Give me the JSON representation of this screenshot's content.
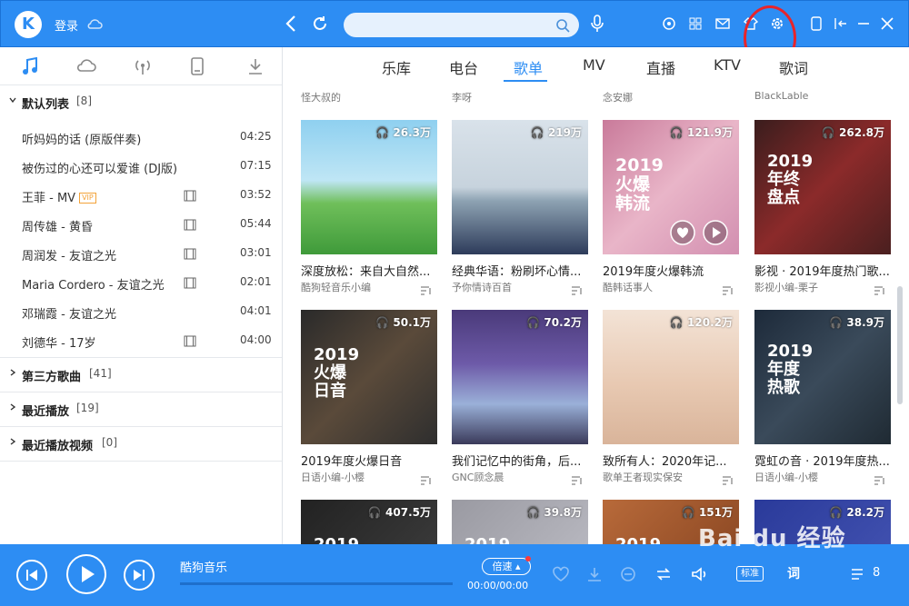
{
  "app": {
    "logo_letter": "K",
    "login": "登录",
    "search_placeholder": ""
  },
  "sidebar": {
    "groups": [
      {
        "name": "默认列表",
        "count": "[8]",
        "expanded": true
      },
      {
        "name": "第三方歌曲",
        "count": "[41]",
        "expanded": false
      },
      {
        "name": "最近播放",
        "count": "[19]",
        "expanded": false
      },
      {
        "name": "最近播放视频",
        "count": "[0]",
        "expanded": false
      }
    ],
    "songs": [
      {
        "name": "听妈妈的话 (原版伴奏)",
        "dur": "04:25",
        "mv": false,
        "vip": false
      },
      {
        "name": "被伤过的心还可以爱谁 (DJ版)",
        "dur": "07:15",
        "mv": false,
        "vip": false
      },
      {
        "name": "王菲 - MV",
        "dur": "03:52",
        "mv": true,
        "vip": true
      },
      {
        "name": "周传雄 - 黄昏",
        "dur": "05:44",
        "mv": true,
        "vip": false
      },
      {
        "name": "周润发 - 友谊之光",
        "dur": "03:01",
        "mv": true,
        "vip": false
      },
      {
        "name": "Maria Cordero - 友谊之光",
        "dur": "02:01",
        "mv": true,
        "vip": false
      },
      {
        "name": "邓瑞霞 - 友谊之光",
        "dur": "04:01",
        "mv": false,
        "vip": false
      },
      {
        "name": "刘德华 - 17岁",
        "dur": "04:00",
        "mv": true,
        "vip": false
      }
    ],
    "vip_label": "VIP"
  },
  "tabs": [
    "乐库",
    "电台",
    "歌单",
    "MV",
    "直播",
    "KTV",
    "歌词"
  ],
  "active_tab": "歌单",
  "top_partial_authors": [
    "怪大叔的",
    "李呀",
    "念安娜",
    "BlackLable"
  ],
  "playlists": [
    {
      "plays": "26.3万",
      "title": "深度放松：来自大自然...",
      "author": "酷狗轻音乐小编",
      "big": ""
    },
    {
      "plays": "219万",
      "title": "经典华语：粉刷坏心情...",
      "author": "予你情诗百首",
      "big": ""
    },
    {
      "plays": "121.9万",
      "title": "2019年度火爆韩流",
      "author": "酷韩话事人",
      "big": "2019\n火爆\n韩流"
    },
    {
      "plays": "262.8万",
      "title": "影视 · 2019年度热门歌...",
      "author": "影视小编-栗子",
      "big": "2019\n年终\n盘点"
    },
    {
      "plays": "50.1万",
      "title": "2019年度火爆日音",
      "author": "日语小编-小樱",
      "big": "2019\n火爆\n日音"
    },
    {
      "plays": "70.2万",
      "title": "我们记忆中的街角，后...",
      "author": "GNC顾念晨",
      "big": ""
    },
    {
      "plays": "120.2万",
      "title": "致所有人：2020年记...",
      "author": "歌单王者现实保安",
      "big": ""
    },
    {
      "plays": "38.9万",
      "title": "霓虹の音 · 2019年度热...",
      "author": "日语小编-小樱",
      "big": "2019\n年度\n热歌"
    },
    {
      "plays": "407.5万",
      "title": "",
      "author": "",
      "big": "2019"
    },
    {
      "plays": "39.8万",
      "title": "",
      "author": "",
      "big": "2019"
    },
    {
      "plays": "151万",
      "title": "",
      "author": "",
      "big": "2019"
    },
    {
      "plays": "28.2万",
      "title": "",
      "author": "",
      "big": ""
    }
  ],
  "player": {
    "name": "酷狗音乐",
    "speed": "倍速",
    "time": "00:00/00:00",
    "quality": "标准",
    "ci": "词",
    "queue": "8"
  },
  "watermark": "Bai du 经验",
  "colors": {
    "brand": "#2d8df3",
    "annotation": "#e8242a"
  }
}
